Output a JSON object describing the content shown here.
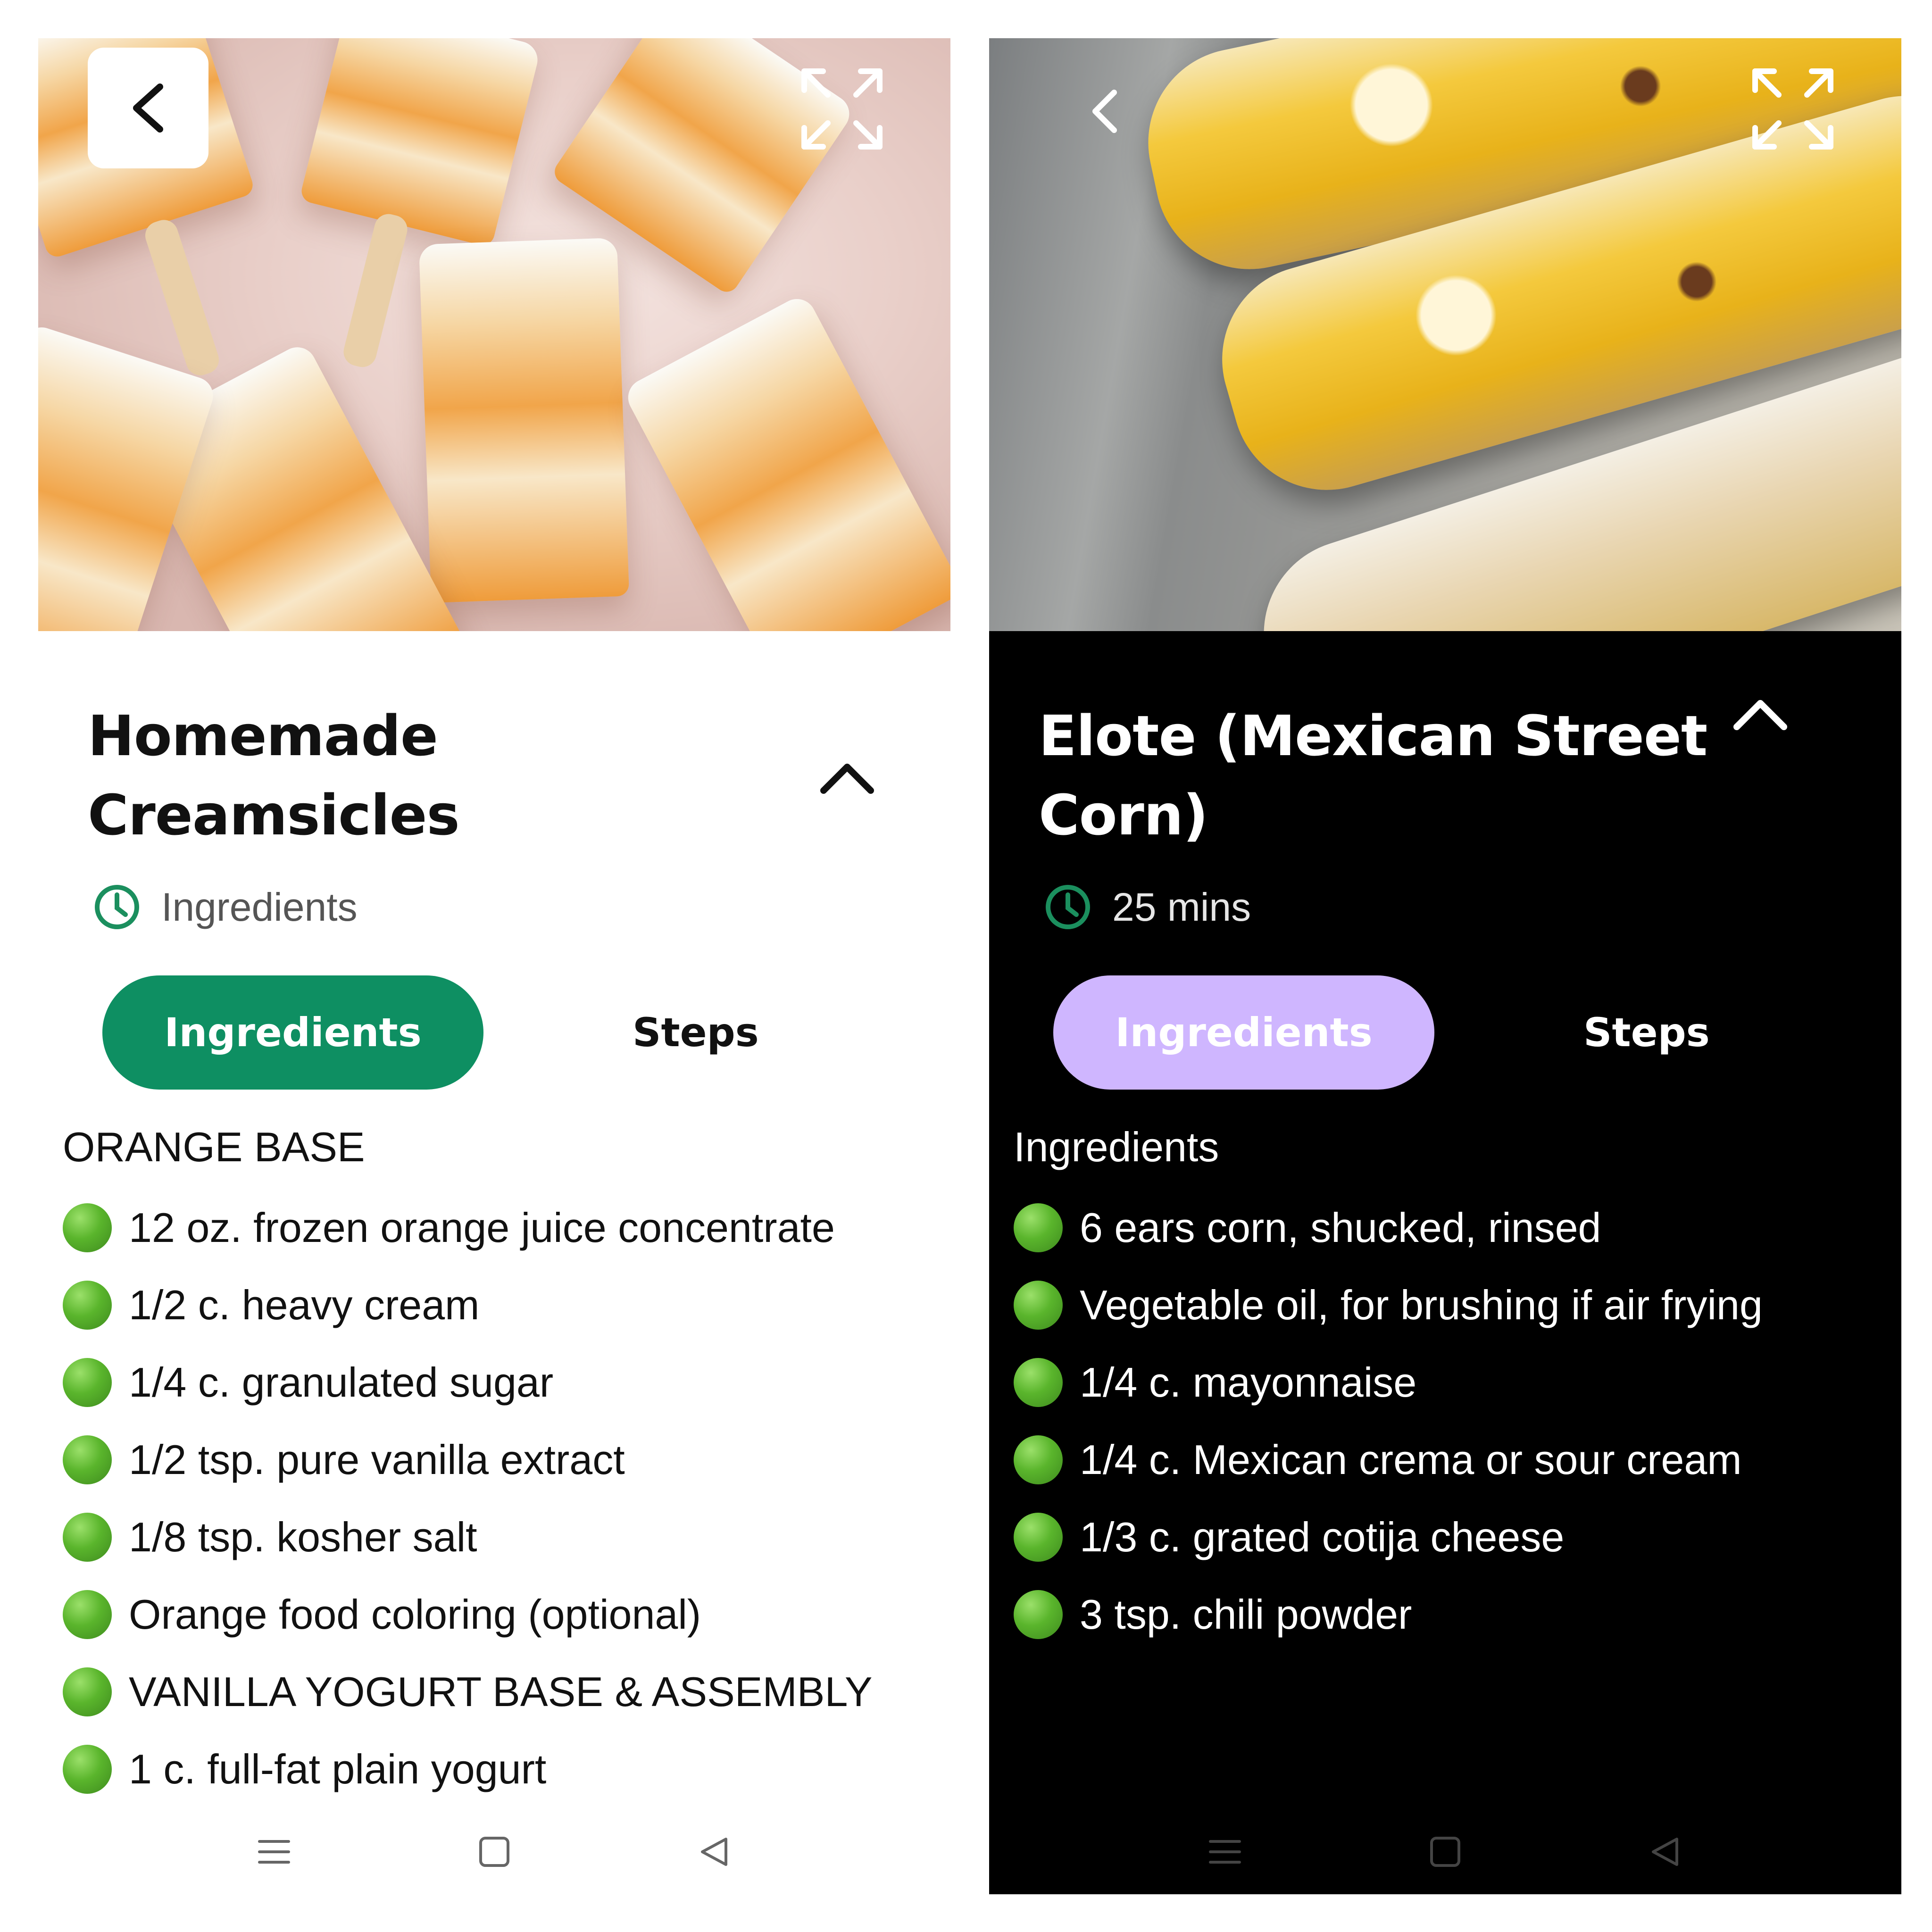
{
  "colors": {
    "green_accent": "#0e8f62",
    "lavender_accent": "#cfb6ff",
    "clock_green": "#1b8f5e",
    "dark_bg": "#000000",
    "light_bg": "#ffffff"
  },
  "screens": [
    {
      "theme": "light",
      "hero_icons": {
        "back": "chevron-left-icon",
        "expand": "expand-icon"
      },
      "title": "Homemade Creamsicles",
      "collapse_icon": "chevron-up-icon",
      "meta": {
        "icon": "clock-icon",
        "text": "Ingredients"
      },
      "tabs": {
        "ingredients": "Ingredients",
        "steps": "Steps"
      },
      "section_title": "ORANGE BASE",
      "ingredients": [
        "12 oz. frozen orange juice concentrate",
        "1/2 c. heavy cream",
        "1/4 c. granulated sugar",
        "1/2 tsp. pure vanilla extract",
        "1/8 tsp. kosher salt",
        "Orange food coloring (optional)",
        "VANILLA YOGURT BASE & ASSEMBLY",
        "1 c. full-fat plain yogurt"
      ],
      "nav": {
        "menu": "menu-icon",
        "home": "home-square-icon",
        "back": "back-triangle-icon"
      }
    },
    {
      "theme": "dark",
      "hero_icons": {
        "back": "chevron-left-icon",
        "expand": "expand-icon"
      },
      "title": "Elote (Mexican Street Corn)",
      "collapse_icon": "chevron-up-icon",
      "meta": {
        "icon": "clock-icon",
        "text": "25 mins"
      },
      "tabs": {
        "ingredients": "Ingredients",
        "steps": "Steps"
      },
      "section_title": "Ingredients",
      "ingredients": [
        "6 ears corn, shucked, rinsed",
        "Vegetable oil, for brushing if air frying",
        "1/4 c. mayonnaise",
        "1/4 c. Mexican crema or sour cream",
        "1/3 c. grated cotija cheese",
        "3 tsp. chili powder"
      ],
      "nav": {
        "menu": "menu-icon",
        "home": "home-square-icon",
        "back": "back-triangle-icon"
      }
    }
  ]
}
